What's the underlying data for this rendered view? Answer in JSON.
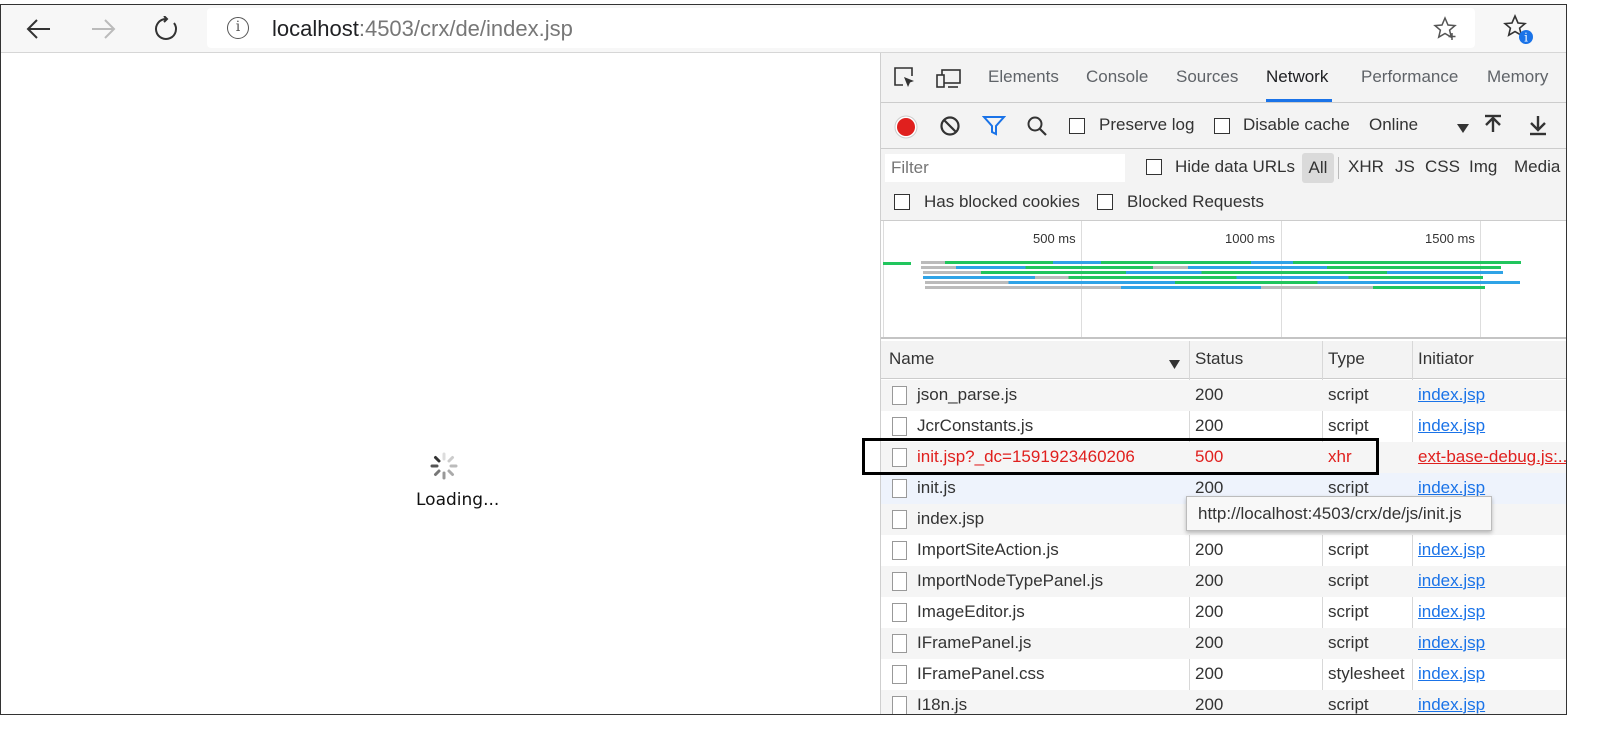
{
  "browser": {
    "url_host": "localhost",
    "url_rest": ":4503/crx/de/index.jsp",
    "info_glyph": "i",
    "icons": [
      "back-arrow-icon",
      "forward-arrow-icon",
      "refresh-icon",
      "site-info-icon",
      "favorite-star-icon",
      "favorites-collection-icon"
    ]
  },
  "page": {
    "loading_text": "Loading..."
  },
  "devtools": {
    "tabs": [
      "Elements",
      "Console",
      "Sources",
      "Network",
      "Performance",
      "Memory"
    ],
    "active_tab": "Network",
    "preserve_log_label": "Preserve log",
    "disable_cache_label": "Disable cache",
    "throttle_value": "Online",
    "filter_placeholder": "Filter",
    "hide_data_urls_label": "Hide data URLs",
    "type_filters": [
      "All",
      "XHR",
      "JS",
      "CSS",
      "Img",
      "Media"
    ],
    "has_blocked_cookies_label": "Has blocked cookies",
    "blocked_requests_label": "Blocked Requests",
    "timeline_ticks": [
      "500 ms",
      "1000 ms",
      "1500 ms"
    ],
    "columns": {
      "name": "Name",
      "status": "Status",
      "type": "Type",
      "initiator": "Initiator"
    },
    "rows": [
      {
        "name": "json_parse.js",
        "status": "200",
        "type": "script",
        "initiator": "index.jsp"
      },
      {
        "name": "JcrConstants.js",
        "status": "200",
        "type": "script",
        "initiator": "index.jsp"
      },
      {
        "name": "init.jsp?_dc=1591923460206",
        "status": "500",
        "type": "xhr",
        "initiator": "ext-base-debug.js:..."
      },
      {
        "name": "init.js",
        "status": "200",
        "type": "script",
        "initiator": "index.jsp"
      },
      {
        "name": "index.jsp",
        "status": "",
        "type": "",
        "initiator": ""
      },
      {
        "name": "ImportSiteAction.js",
        "status": "200",
        "type": "script",
        "initiator": "index.jsp"
      },
      {
        "name": "ImportNodeTypePanel.js",
        "status": "200",
        "type": "script",
        "initiator": "index.jsp"
      },
      {
        "name": "ImageEditor.js",
        "status": "200",
        "type": "script",
        "initiator": "index.jsp"
      },
      {
        "name": "IFramePanel.js",
        "status": "200",
        "type": "script",
        "initiator": "index.jsp"
      },
      {
        "name": "IFramePanel.css",
        "status": "200",
        "type": "stylesheet",
        "initiator": "index.jsp"
      },
      {
        "name": "I18n.js",
        "status": "200",
        "type": "script",
        "initiator": "index.jsp"
      }
    ],
    "tooltip": "http://localhost:4503/crx/de/js/init.js"
  },
  "colors": {
    "accent": "#1a73e8",
    "record": "#e0201e",
    "error_text": "#e0201e",
    "timeline_green": "#21c55d",
    "timeline_blue": "#2fa3e6"
  }
}
